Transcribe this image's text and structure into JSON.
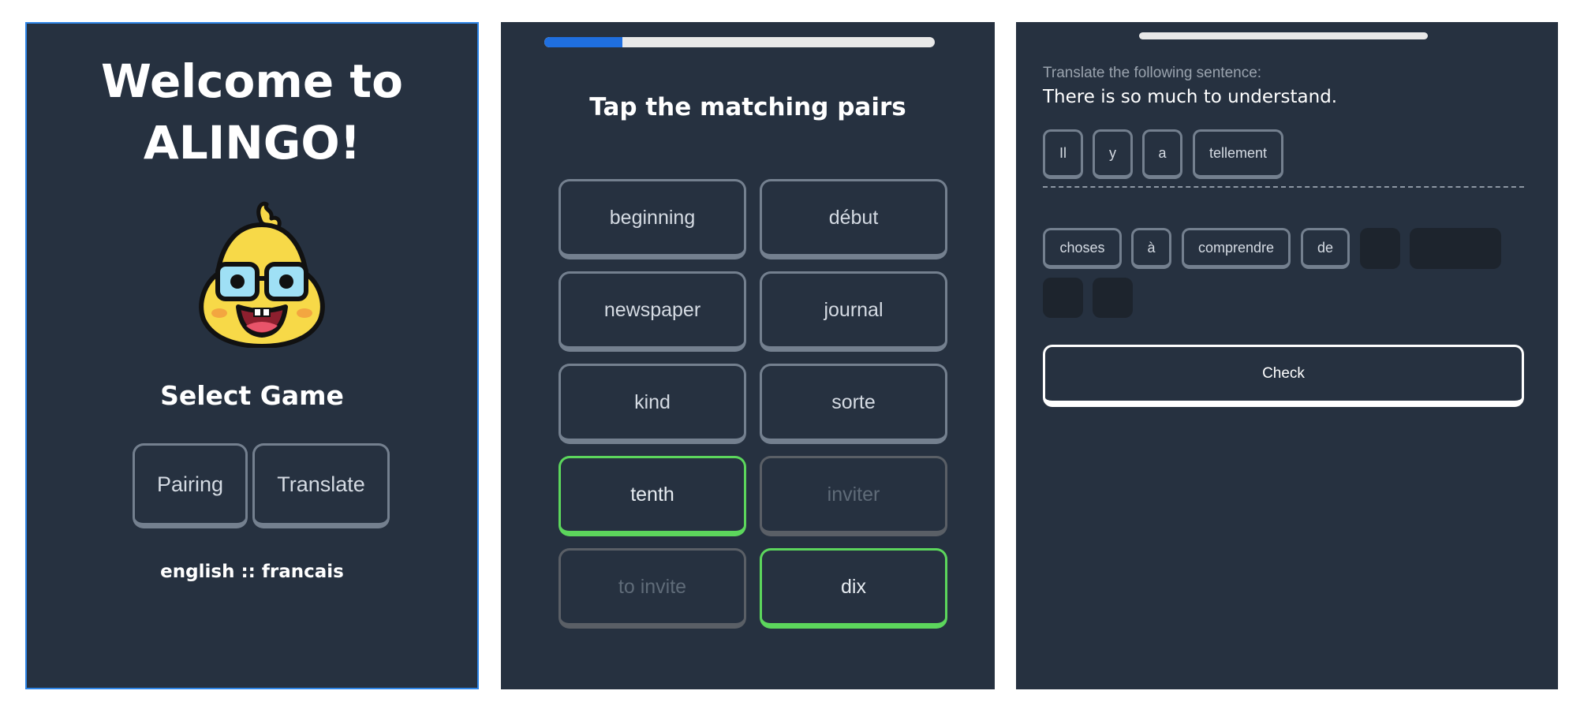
{
  "home": {
    "title_line1": "Welcome to",
    "title_line2": "ALINGO!",
    "mascot": "chick-with-glasses-icon",
    "select_game_label": "Select Game",
    "buttons": {
      "pairing": "Pairing",
      "translate": "Translate"
    },
    "language_pair": "english :: francais"
  },
  "pairs": {
    "progress": 0.2,
    "title": "Tap the matching pairs",
    "tiles": [
      {
        "label": "beginning",
        "state": "default"
      },
      {
        "label": "début",
        "state": "default"
      },
      {
        "label": "newspaper",
        "state": "default"
      },
      {
        "label": "journal",
        "state": "default"
      },
      {
        "label": "kind",
        "state": "default"
      },
      {
        "label": "sorte",
        "state": "default"
      },
      {
        "label": "tenth",
        "state": "correct"
      },
      {
        "label": "inviter",
        "state": "done"
      },
      {
        "label": "to invite",
        "state": "done"
      },
      {
        "label": "dix",
        "state": "correct"
      }
    ]
  },
  "translate": {
    "prompt_label": "Translate the following sentence:",
    "sentence": "There is so much to understand.",
    "answer_words": [
      "Il",
      "y",
      "a",
      "tellement"
    ],
    "bank_words": [
      "choses",
      "à",
      "comprendre",
      "de"
    ],
    "check_label": "Check"
  },
  "colors": {
    "panel_bg": "#263140",
    "accent_blue": "#1f6fe0",
    "correct_green": "#5cd65c",
    "tile_border": "#74808f"
  }
}
